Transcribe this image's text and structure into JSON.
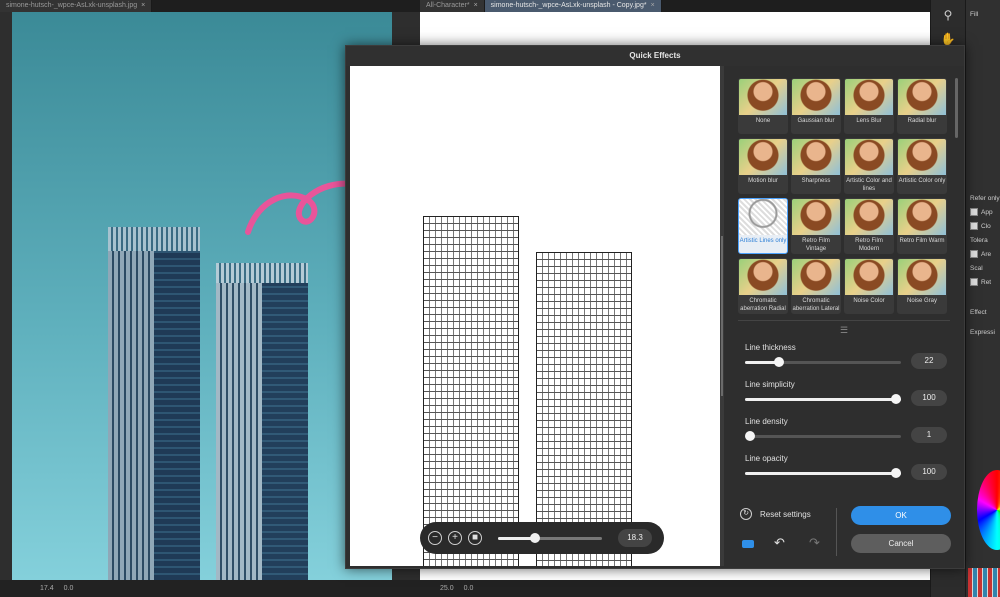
{
  "tabs_left": [
    {
      "label": "simone-hutsch-_wpce-AsLxk-unsplash.jpg",
      "close": "×"
    }
  ],
  "tabs_center": [
    {
      "label": "All-Character*",
      "close": "×"
    },
    {
      "label": "simone-hutsch-_wpce-AsLxk-unsplash - Copy.jpg*",
      "close": "×"
    }
  ],
  "left_status": {
    "zoom": "17.4",
    "angle": "0.0"
  },
  "center_status": {
    "zoom": "25.0",
    "angle": "0.0"
  },
  "right_panel": {
    "fill_label": "Fill",
    "rows": [
      "Refer only",
      "App",
      "Clo",
      "Tolera",
      "Are",
      "Scal",
      "Ret",
      "Effect",
      "Expressi"
    ]
  },
  "dialog": {
    "title": "Quick Effects",
    "zoom_value": "18.3",
    "zoom_fraction": 0.36,
    "effects": [
      {
        "label": "None"
      },
      {
        "label": "Gaussian blur"
      },
      {
        "label": "Lens Blur"
      },
      {
        "label": "Radial blur"
      },
      {
        "label": "Motion blur"
      },
      {
        "label": "Sharpness"
      },
      {
        "label": "Artistic Color and lines"
      },
      {
        "label": "Artistic Color only"
      },
      {
        "label": "Artistic Lines only"
      },
      {
        "label": "Retro Film Vintage"
      },
      {
        "label": "Retro Film Modern"
      },
      {
        "label": "Retro Film Warm"
      },
      {
        "label": "Chromatic aberration Radial"
      },
      {
        "label": "Chromatic aberration Lateral"
      },
      {
        "label": "Noise Color"
      },
      {
        "label": "Noise Gray"
      }
    ],
    "selected_effect": "Artistic Lines only",
    "params": [
      {
        "label": "Line thickness",
        "value": "22",
        "fraction": 0.22
      },
      {
        "label": "Line simplicity",
        "value": "100",
        "fraction": 1.0
      },
      {
        "label": "Line density",
        "value": "1",
        "fraction": 0.0
      },
      {
        "label": "Line opacity",
        "value": "100",
        "fraction": 1.0
      }
    ],
    "reset_label": "Reset settings",
    "ok_label": "OK",
    "cancel_label": "Cancel"
  },
  "colors": {
    "accent": "#2f8fe8",
    "arrow": "#e8559a"
  }
}
